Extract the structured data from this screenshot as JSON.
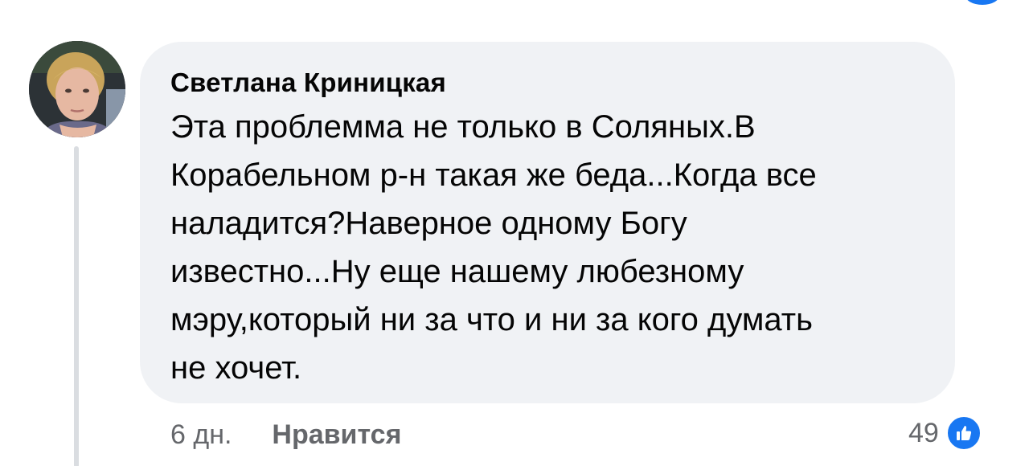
{
  "comment": {
    "author": "Светлана Криницкая",
    "text": "Эта проблемма не только в Соляных.В\nКорабельном р-н такая же беда...Когда все\nналадится?Наверное одному Богу\nизвестно...Ну еще нашему любезному\nмэру,который ни за что и ни за кого думать\nне хочет.",
    "time": "6 дн.",
    "like_label": "Нравится",
    "reaction_count": "49",
    "reaction_icon": "like-thumbs-up-icon"
  },
  "colors": {
    "bubble_bg": "#f0f2f5",
    "secondary_text": "#65676b",
    "primary_text": "#050505",
    "accent": "#1877f2",
    "thread_line": "#dadde1"
  }
}
